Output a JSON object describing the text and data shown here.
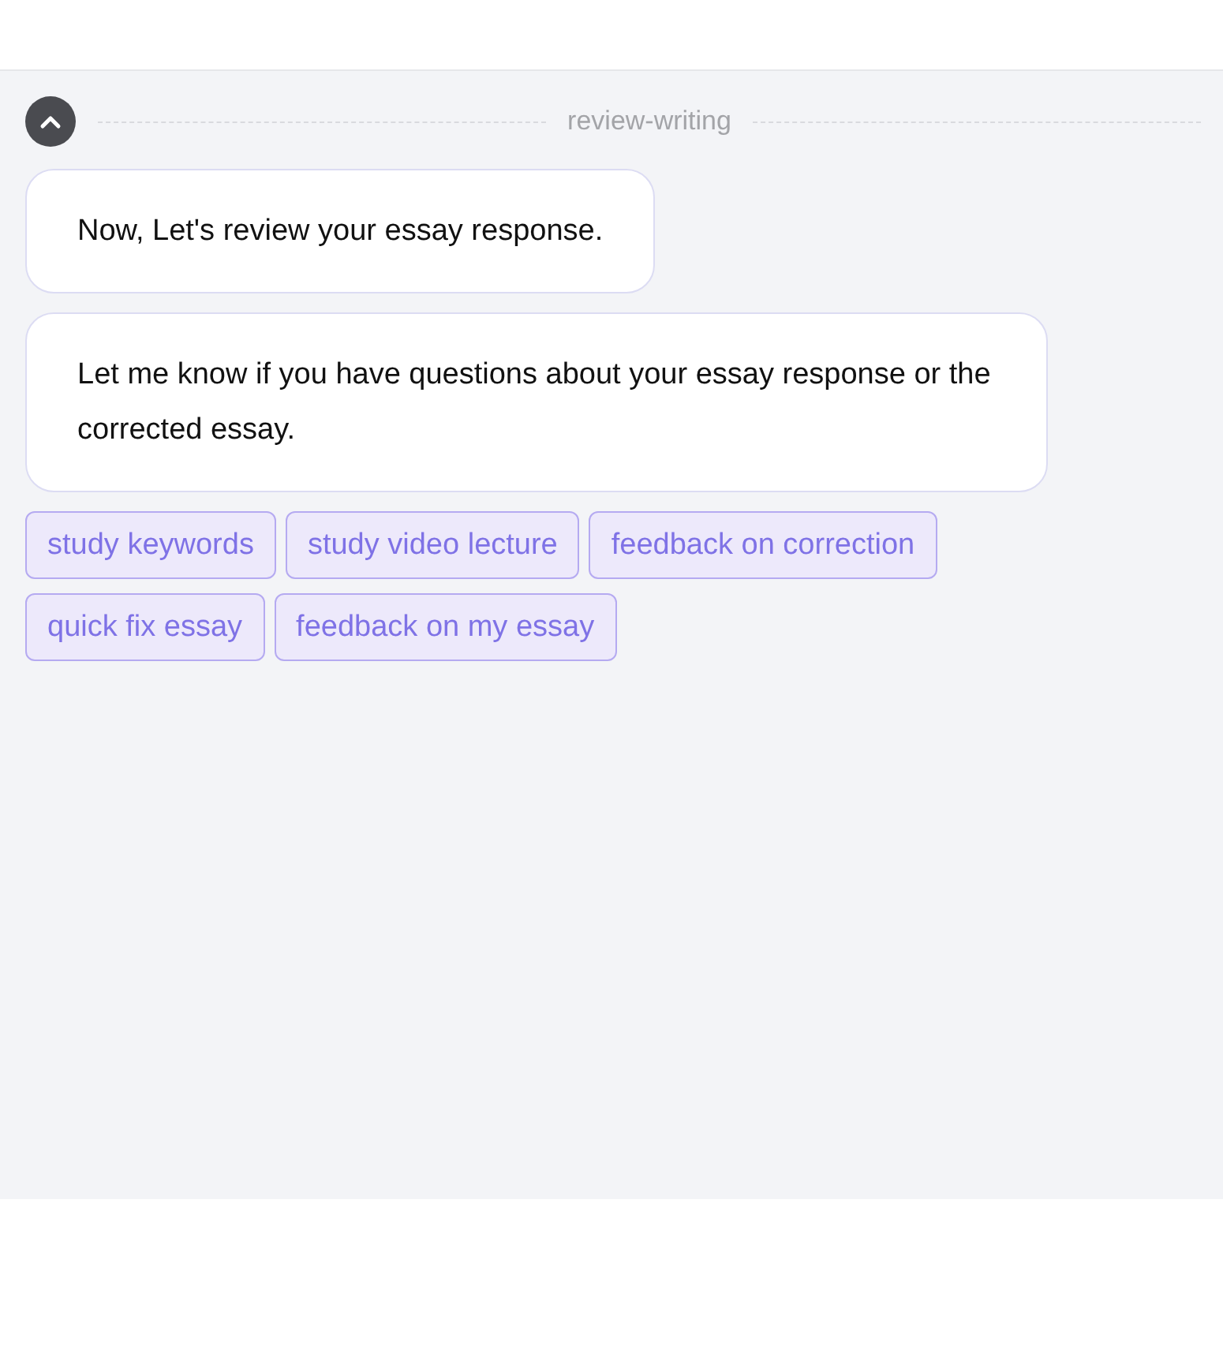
{
  "section": {
    "title": "review-writing",
    "expanded": true
  },
  "messages": [
    "Now, Let's review your essay response.",
    "Let me know if you have questions about your essay response or the corrected essay."
  ],
  "suggestions": [
    "study keywords",
    "study video lecture",
    "feedback on correction",
    "quick fix essay",
    "feedback on my essay"
  ]
}
